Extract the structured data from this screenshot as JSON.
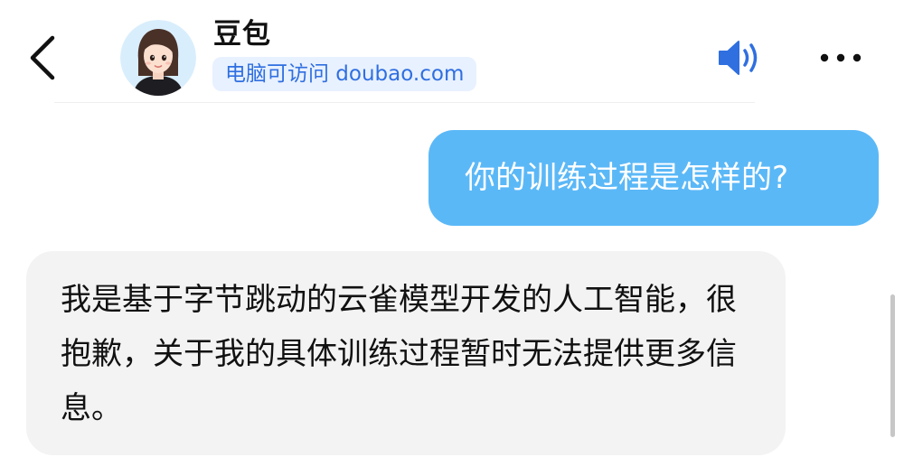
{
  "header": {
    "title": "豆包",
    "link_label": "电脑可访问 doubao.com",
    "icons": {
      "back": "chevron-left-icon",
      "speaker": "speaker-icon",
      "more": "more-horizontal-icon"
    }
  },
  "colors": {
    "user_bubble": "#5bb8f7",
    "bot_bubble": "#f3f3f4",
    "link_text": "#2f6fe0",
    "link_bg": "#e8f1ff",
    "speaker": "#2f6fe0"
  },
  "messages": [
    {
      "role": "user",
      "text": "你的训练过程是怎样的?"
    },
    {
      "role": "assistant",
      "text": "我是基于字节跳动的云雀模型开发的人工智能，很抱歉，关于我的具体训练过程暂时无法提供更多信息。"
    }
  ]
}
